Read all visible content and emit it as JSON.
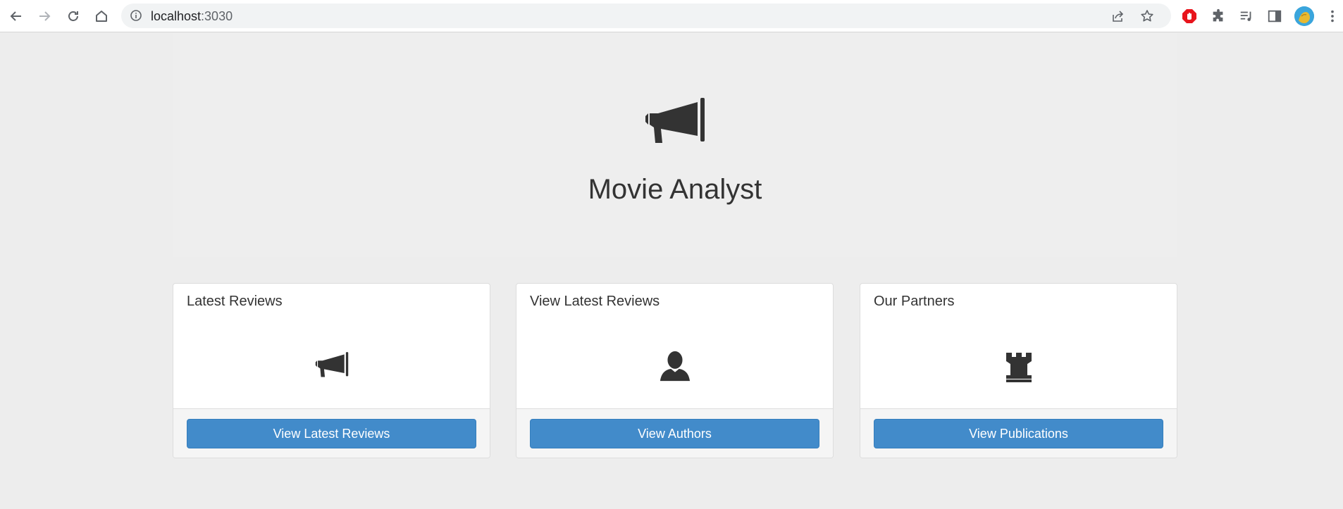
{
  "browser": {
    "url_host": "localhost",
    "url_port": ":3030",
    "icons": [
      "back-icon",
      "forward-icon",
      "reload-icon",
      "home-icon",
      "info-icon",
      "share-icon",
      "bookmark-star-icon",
      "adblock-icon",
      "extensions-icon",
      "media-queue-icon",
      "side-panel-icon",
      "profile-avatar",
      "menu-kebab-icon"
    ],
    "adblock_color": "#e8141c"
  },
  "hero": {
    "icon": "bullhorn-icon",
    "title": "Movie Analyst"
  },
  "panels": [
    {
      "heading": "Latest Reviews",
      "icon": "bullhorn-icon",
      "button": "View Latest Reviews"
    },
    {
      "heading": "View Latest Reviews",
      "icon": "user-icon",
      "button": "View Authors"
    },
    {
      "heading": "Our Partners",
      "icon": "tower-icon",
      "button": "View Publications"
    }
  ],
  "colors": {
    "button": "#428bca",
    "page_bg": "#ededed",
    "text": "#333333"
  }
}
